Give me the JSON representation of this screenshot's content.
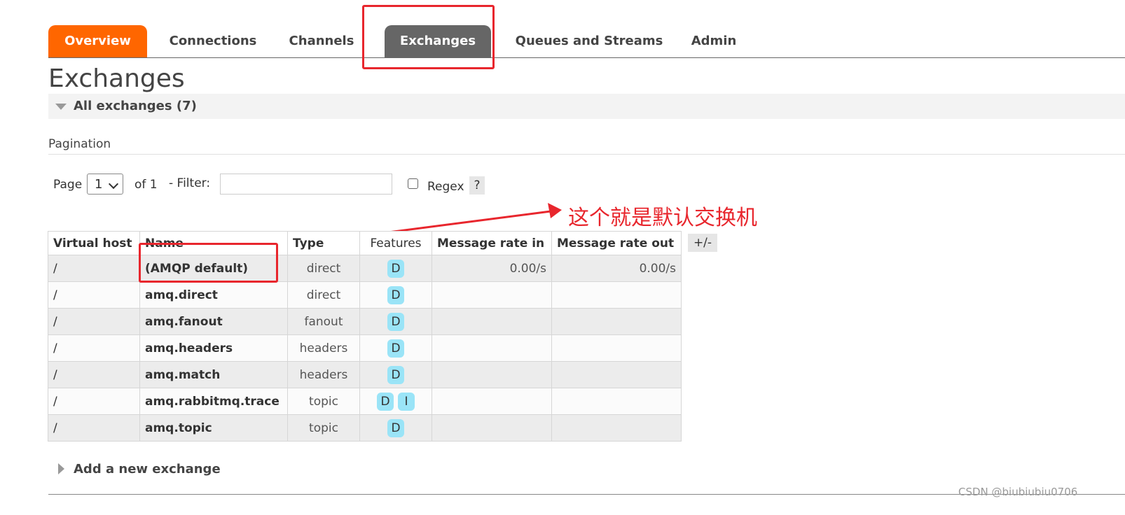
{
  "nav": {
    "tabs": [
      {
        "label": "Overview"
      },
      {
        "label": "Connections"
      },
      {
        "label": "Channels"
      },
      {
        "label": "Exchanges"
      },
      {
        "label": "Queues and Streams"
      },
      {
        "label": "Admin"
      }
    ],
    "active": "Exchanges"
  },
  "page": {
    "title": "Exchanges",
    "section_label": "All exchanges (7)",
    "pagination_label": "Pagination"
  },
  "pagination": {
    "page_label": "Page",
    "page_value": "1",
    "of_label": "of 1",
    "filter_label": "- Filter:",
    "filter_value": "",
    "regex_label": "Regex",
    "help_label": "?"
  },
  "annotation": {
    "text": "这个就是默认交换机",
    "color": "#e8262d"
  },
  "table": {
    "columns": [
      "Virtual host",
      "Name",
      "Type",
      "Features",
      "Message rate in",
      "Message rate out"
    ],
    "columns_toggle": "+/-",
    "rows": [
      {
        "vhost": "/",
        "name": "(AMQP default)",
        "type": "direct",
        "features": [
          "D"
        ],
        "rate_in": "0.00/s",
        "rate_out": "0.00/s"
      },
      {
        "vhost": "/",
        "name": "amq.direct",
        "type": "direct",
        "features": [
          "D"
        ],
        "rate_in": "",
        "rate_out": ""
      },
      {
        "vhost": "/",
        "name": "amq.fanout",
        "type": "fanout",
        "features": [
          "D"
        ],
        "rate_in": "",
        "rate_out": ""
      },
      {
        "vhost": "/",
        "name": "amq.headers",
        "type": "headers",
        "features": [
          "D"
        ],
        "rate_in": "",
        "rate_out": ""
      },
      {
        "vhost": "/",
        "name": "amq.match",
        "type": "headers",
        "features": [
          "D"
        ],
        "rate_in": "",
        "rate_out": ""
      },
      {
        "vhost": "/",
        "name": "amq.rabbitmq.trace",
        "type": "topic",
        "features": [
          "D",
          "I"
        ],
        "rate_in": "",
        "rate_out": ""
      },
      {
        "vhost": "/",
        "name": "amq.topic",
        "type": "topic",
        "features": [
          "D"
        ],
        "rate_in": "",
        "rate_out": ""
      }
    ]
  },
  "add_section": {
    "label": "Add a new exchange"
  },
  "watermark": "CSDN @biubiubiu0706",
  "colors": {
    "brand": "#ff6600",
    "active_tab": "#666666",
    "feature_badge": "#9ae4f7",
    "annotation": "#e8262d"
  }
}
